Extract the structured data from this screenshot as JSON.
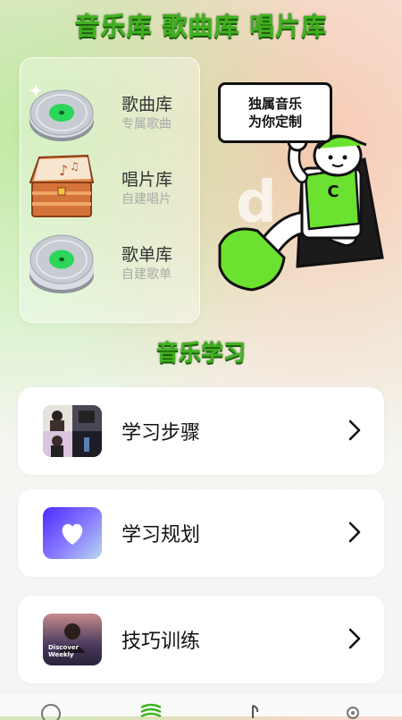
{
  "header": {
    "title": "音乐库 歌曲库 唱片库"
  },
  "libraries": [
    {
      "name": "歌曲库",
      "sub": "专属歌曲",
      "icon": "vinyl-disc-icon"
    },
    {
      "name": "唱片库",
      "sub": "自建唱片",
      "icon": "treasure-chest-icon"
    },
    {
      "name": "歌单库",
      "sub": "自建歌单",
      "icon": "vinyl-disc-icon"
    }
  ],
  "promo": {
    "bubble_line1": "独属音乐",
    "bubble_line2": "为你定制",
    "mascot_letter": "C"
  },
  "section": {
    "title": "音乐学习"
  },
  "cards": [
    {
      "label": "学习步骤",
      "icon": "photo-collage-icon"
    },
    {
      "label": "学习规划",
      "icon": "heart-icon"
    },
    {
      "label": "技巧训练",
      "icon": "playlist-cover-icon",
      "cover_text": "Discover Weekly"
    }
  ],
  "nav": [
    "compass-icon",
    "waves-icon",
    "music-note-icon",
    "pin-icon"
  ],
  "colors": {
    "accent_green": "#3fb21e",
    "dark_green": "#1d5a0e",
    "disc_green": "#2bd65a"
  }
}
